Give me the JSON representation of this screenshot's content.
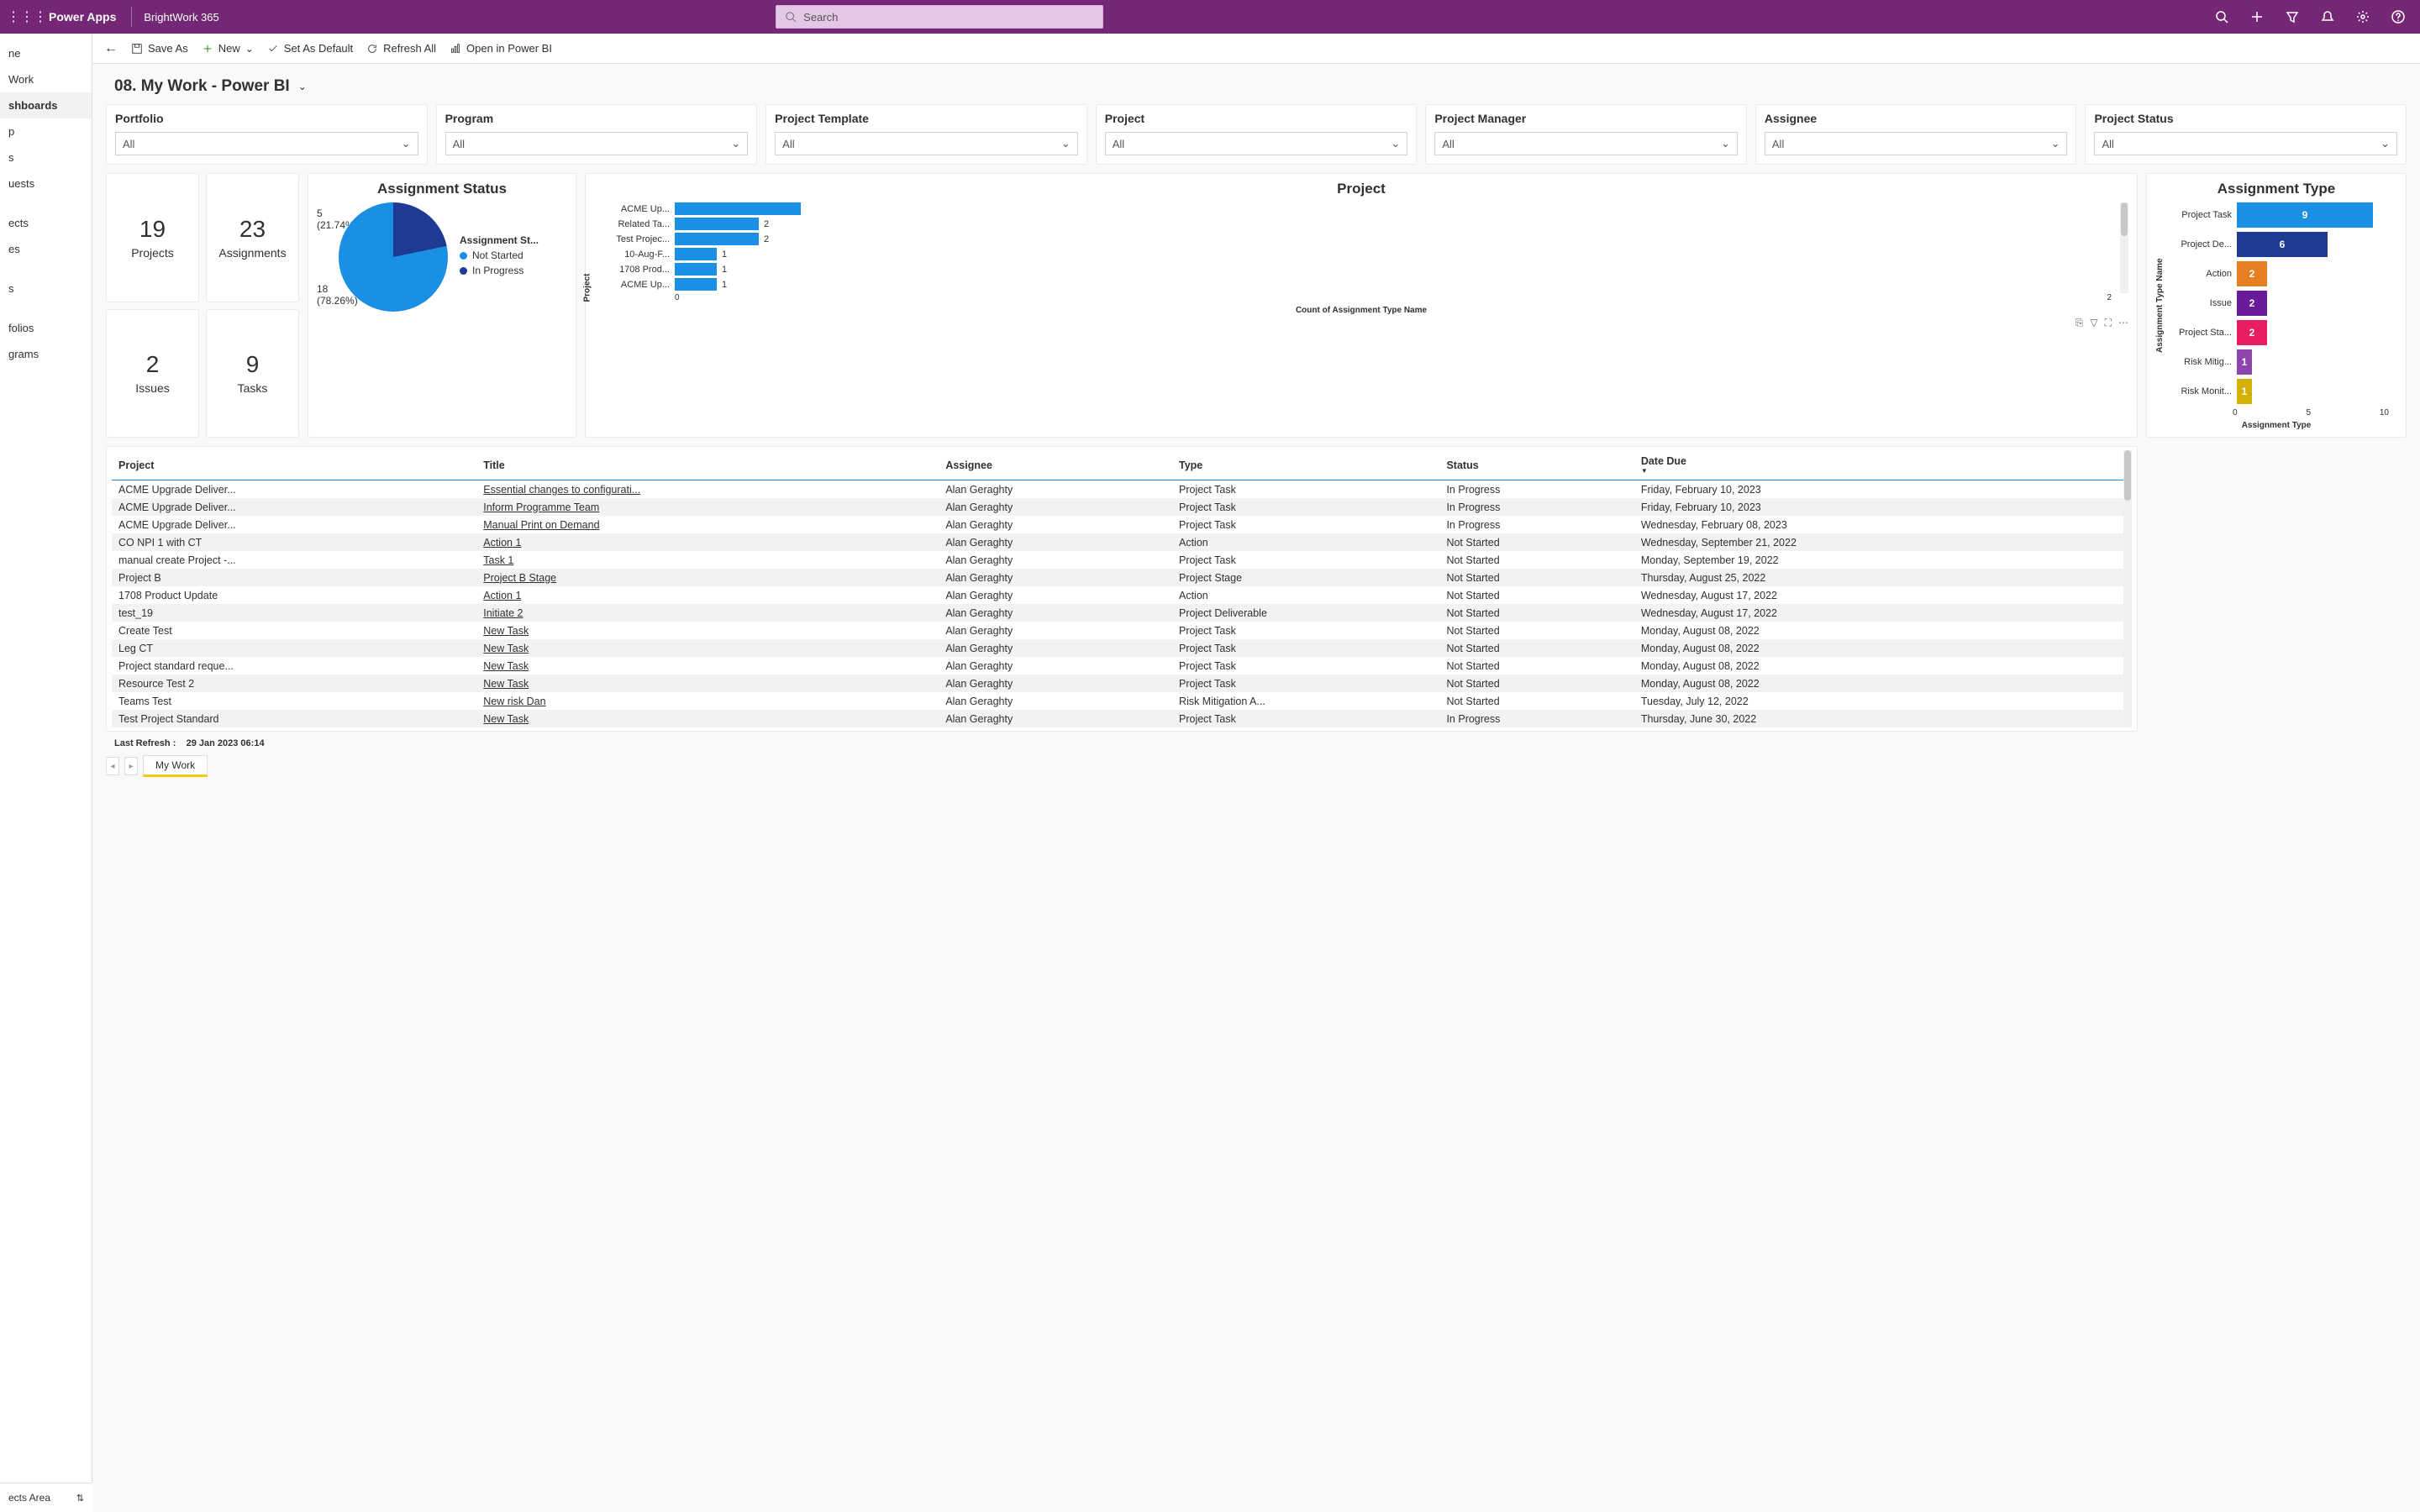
{
  "topbar": {
    "app_name": "Power Apps",
    "env_name": "BrightWork 365",
    "search_placeholder": "Search"
  },
  "commands": {
    "save_as": "Save As",
    "new": "New",
    "set_default": "Set As Default",
    "refresh": "Refresh All",
    "open_pbi": "Open in Power BI"
  },
  "page_title": "08. My Work - Power BI",
  "leftnav": {
    "items": [
      "ne",
      "Work",
      "shboards",
      "p",
      "s",
      "uests",
      "",
      "ects",
      "es",
      "",
      "s",
      "",
      "folios",
      "grams"
    ],
    "active_index": 2,
    "footer_label": "ects Area"
  },
  "filters": [
    {
      "label": "Portfolio",
      "value": "All"
    },
    {
      "label": "Program",
      "value": "All"
    },
    {
      "label": "Project Template",
      "value": "All"
    },
    {
      "label": "Project",
      "value": "All"
    },
    {
      "label": "Project Manager",
      "value": "All"
    },
    {
      "label": "Assignee",
      "value": "All"
    },
    {
      "label": "Project Status",
      "value": "All"
    }
  ],
  "kpis": [
    {
      "value": "19",
      "label": "Projects"
    },
    {
      "value": "23",
      "label": "Assignments"
    },
    {
      "value": "2",
      "label": "Issues"
    },
    {
      "value": "9",
      "label": "Tasks"
    }
  ],
  "pie": {
    "title": "Assignment Status",
    "legend_title": "Assignment St...",
    "seg1": {
      "label": "5",
      "pct": "(21.74%)",
      "name": "In Progress",
      "color": "#1f3a93"
    },
    "seg2": {
      "label": "18",
      "pct": "(78.26%)",
      "name": "Not Started",
      "color": "#1a8fe3"
    }
  },
  "project_chart": {
    "title": "Project",
    "yaxis": "Project",
    "xaxis": "Count of Assignment Type Name",
    "xticks": [
      "0",
      "2"
    ]
  },
  "assign_type": {
    "title": "Assignment Type",
    "yaxis": "Assignment Type Name",
    "xaxis": "Assignment Type",
    "xticks": [
      "0",
      "5",
      "10"
    ]
  },
  "table": {
    "headers": [
      "Project",
      "Title",
      "Assignee",
      "Type",
      "Status",
      "Date Due"
    ]
  },
  "chart_data": {
    "pie_assignment_status": {
      "type": "pie",
      "title": "Assignment Status",
      "slices": [
        {
          "name": "In Progress",
          "value": 5,
          "pct": 21.74,
          "color": "#1f3a93"
        },
        {
          "name": "Not Started",
          "value": 18,
          "pct": 78.26,
          "color": "#1a8fe3"
        }
      ]
    },
    "project_bar": {
      "type": "bar",
      "orientation": "horizontal",
      "title": "Project",
      "xlabel": "Count of Assignment Type Name",
      "ylabel": "Project",
      "xlim": [
        0,
        3
      ],
      "categories": [
        "ACME Up...",
        "Related Ta...",
        "Test Projec...",
        "10-Aug-F...",
        "1708 Prod...",
        "ACME Up..."
      ],
      "values": [
        3,
        2,
        2,
        1,
        1,
        1
      ],
      "color": "#1a8fe3"
    },
    "assignment_type_bar": {
      "type": "bar",
      "orientation": "horizontal",
      "title": "Assignment Type",
      "xlabel": "Assignment Type",
      "ylabel": "Assignment Type Name",
      "xlim": [
        0,
        10
      ],
      "series": [
        {
          "name": "Project Task",
          "value": 9,
          "color": "#1a8fe3"
        },
        {
          "name": "Project De...",
          "value": 6,
          "color": "#1f3a93"
        },
        {
          "name": "Action",
          "value": 2,
          "color": "#e67e22"
        },
        {
          "name": "Issue",
          "value": 2,
          "color": "#6a1b9a"
        },
        {
          "name": "Project Sta...",
          "value": 2,
          "color": "#e91e63"
        },
        {
          "name": "Risk Mitig...",
          "value": 1,
          "color": "#8e44ad"
        },
        {
          "name": "Risk Monit...",
          "value": 1,
          "color": "#d4b106"
        }
      ]
    },
    "assignments_table": {
      "type": "table",
      "columns": [
        "Project",
        "Title",
        "Assignee",
        "Type",
        "Status",
        "Date Due"
      ],
      "rows": [
        [
          "ACME Upgrade Deliver...",
          "Essential changes to configurati...",
          "Alan Geraghty",
          "Project Task",
          "In Progress",
          "Friday, February 10, 2023"
        ],
        [
          "ACME Upgrade Deliver...",
          "Inform Programme Team",
          "Alan Geraghty",
          "Project Task",
          "In Progress",
          "Friday, February 10, 2023"
        ],
        [
          "ACME Upgrade Deliver...",
          "Manual Print on Demand",
          "Alan Geraghty",
          "Project Task",
          "In Progress",
          "Wednesday, February 08, 2023"
        ],
        [
          "CO NPI 1 with CT",
          "Action 1",
          "Alan Geraghty",
          "Action",
          "Not Started",
          "Wednesday, September 21, 2022"
        ],
        [
          "manual create Project -...",
          "Task 1",
          "Alan Geraghty",
          "Project Task",
          "Not Started",
          "Monday, September 19, 2022"
        ],
        [
          "Project B",
          "Project B Stage",
          "Alan Geraghty",
          "Project Stage",
          "Not Started",
          "Thursday, August 25, 2022"
        ],
        [
          "1708 Product Update",
          "Action 1",
          "Alan Geraghty",
          "Action",
          "Not Started",
          "Wednesday, August 17, 2022"
        ],
        [
          "test_19",
          "Initiate 2",
          "Alan Geraghty",
          "Project Deliverable",
          "Not Started",
          "Wednesday, August 17, 2022"
        ],
        [
          "Create Test",
          "New Task",
          "Alan Geraghty",
          "Project Task",
          "Not Started",
          "Monday, August 08, 2022"
        ],
        [
          "Leg CT",
          "New Task",
          "Alan Geraghty",
          "Project Task",
          "Not Started",
          "Monday, August 08, 2022"
        ],
        [
          "Project standard reque...",
          "New Task",
          "Alan Geraghty",
          "Project Task",
          "Not Started",
          "Monday, August 08, 2022"
        ],
        [
          "Resource Test 2",
          "New Task",
          "Alan Geraghty",
          "Project Task",
          "Not Started",
          "Monday, August 08, 2022"
        ],
        [
          "Teams Test",
          "New risk Dan",
          "Alan Geraghty",
          "Risk Mitigation A...",
          "Not Started",
          "Tuesday, July 12, 2022"
        ],
        [
          "Test Project Standard",
          "New Task",
          "Alan Geraghty",
          "Project Task",
          "In Progress",
          "Thursday, June 30, 2022"
        ]
      ]
    }
  },
  "footer": {
    "refresh_label": "Last Refresh :",
    "refresh_value": "29 Jan 2023 06:14",
    "sheet_tab": "My Work"
  }
}
